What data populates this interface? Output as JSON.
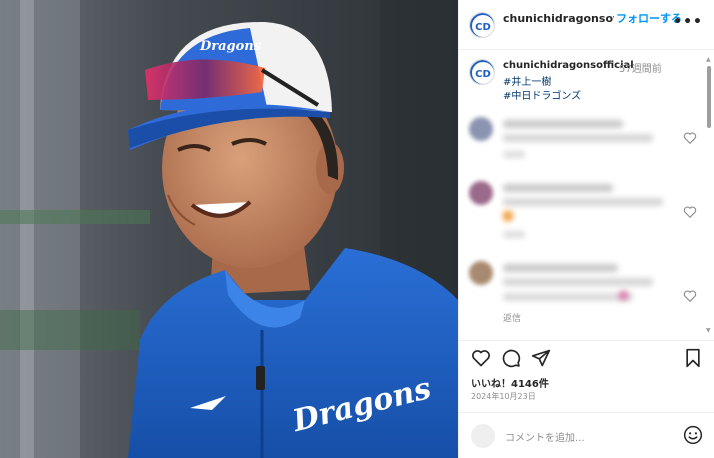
{
  "header": {
    "username": "chunichidragonsofficial",
    "follow_label": "フォローする",
    "more_label": "•••"
  },
  "caption": {
    "username": "chunichidragonsofficial",
    "time": "57週間前",
    "tags": [
      "#井上一樹",
      "#中日ドラゴンズ"
    ]
  },
  "comments": {
    "reply_label": "返信"
  },
  "post": {
    "likes": "いいね！4146件",
    "date": "2024年10月23日",
    "jersey_text": "Dragons",
    "cap_text": "Dragons"
  },
  "composer": {
    "placeholder": "コメントを追加..."
  },
  "icons": [
    "team-logo-icon",
    "heart-icon",
    "comment-icon",
    "share-icon",
    "bookmark-icon",
    "emoji-icon"
  ],
  "colors": {
    "link": "#0095f6",
    "hashtag": "#00376b",
    "jersey": "#1f5fc4",
    "muted": "#8e8e8e"
  }
}
